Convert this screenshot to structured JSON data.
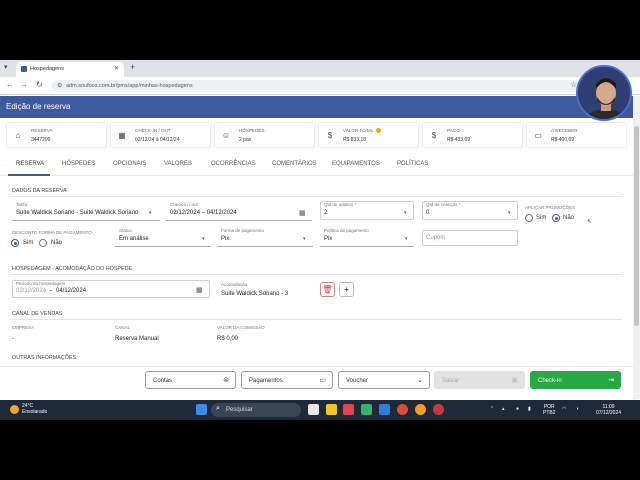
{
  "browser": {
    "tab_title": "Hospedagens",
    "url": "adm.soufoco.com.br/pms/app/minhas-hospedagens"
  },
  "header": {
    "title": "Edição de reserva"
  },
  "cards": [
    {
      "label": "RESERVA",
      "value": "3447299",
      "icon": "bed-icon"
    },
    {
      "label": "CHECK-IN / OUT",
      "value": "02/12/24 à 04/12/24",
      "icon": "calendar-icon"
    },
    {
      "label": "HÓSPEDES",
      "value": "2 pax",
      "icon": "people-icon"
    },
    {
      "label": "VALOR TOTAL",
      "value": "R$ 833,18",
      "icon": "money-icon"
    },
    {
      "label": "PAGO",
      "value": "R$ 433,09",
      "icon": "money-icon"
    },
    {
      "label": "À RECEBER",
      "value": "R$ 400,09",
      "icon": "card-icon"
    }
  ],
  "tabs": [
    "RESERVA",
    "HÓSPEDES",
    "OPCIONAIS",
    "VALORES",
    "OCORRÊNCIAS",
    "COMENTÁRIOS",
    "EQUIPAMENTOS",
    "POLÍTICAS"
  ],
  "dados": {
    "section_title": "DADOS DA RESERVA",
    "tarifa_label": "Tarifa",
    "tarifa_value": "Suite Waldick Soriano - Suite Waldick Soriano",
    "checkin_label": "Check-in / out",
    "checkin_value": "02/12/2024 – 04/12/2024",
    "adultos_label": "Qtd de adultos *",
    "adultos_value": "2",
    "criancas_label": "Qtd de crianças *",
    "criancas_value": "0",
    "promo_label": "APLICAR PROMOÇÕES",
    "sim": "Sim",
    "nao": "Não",
    "desconto_label": "DESCONTO FORMA DE PAGAMENTO",
    "status_label": "Status",
    "status_value": "Em análise",
    "forma_label": "Forma de pagamento",
    "forma_value": "Pix",
    "politica_label": "Política de pagamento",
    "politica_value": "Pix",
    "cupom_placeholder": "Cupom"
  },
  "hospedagem": {
    "section_title": "HOSPEDAGEM - ACOMODAÇÃO DO HÓSPEDE",
    "periodo_label": "Período da hospedagem",
    "periodo_start": "02/12/2024",
    "periodo_end": "04/12/2024",
    "acomodacao_label": "Acomodação",
    "acomodacao_value": "Suite Waldick Soriano - 3"
  },
  "canal": {
    "section_title": "CANAL DE VENDAS",
    "empresa_label": "EMPRESA",
    "empresa_value": "-",
    "canal_label": "CANAL",
    "canal_value": "Reserva Manual",
    "comissao_label": "VALOR DA COMISSÃO",
    "comissao_value": "R$ 0,00"
  },
  "outras": {
    "section_title": "OUTRAS INFORMAÇÕES"
  },
  "footer": {
    "contas": "Contas",
    "pagamentos": "Pagamentos",
    "voucher": "Voucher",
    "salvar": "Salvar",
    "checkin": "Check-in"
  },
  "taskbar": {
    "temp": "24°C",
    "weather": "Ensolarado",
    "search": "Pesquisar",
    "lang1": "POR",
    "lang2": "PTB2",
    "time": "11:09",
    "date": "07/12/2024"
  },
  "colors": {
    "brand": "#3d5a9e",
    "success": "#27a844",
    "danger": "#d23c3c"
  }
}
